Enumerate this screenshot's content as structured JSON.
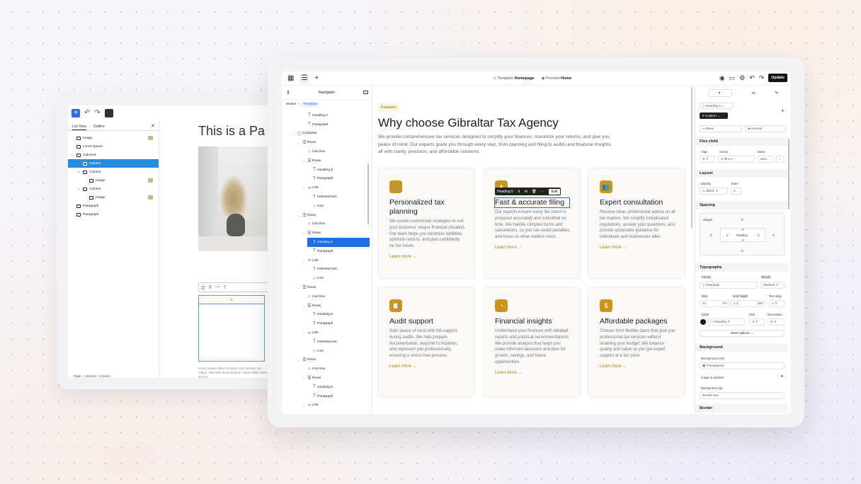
{
  "back_window": {
    "tabs": [
      "List View",
      "Outline"
    ],
    "close": "✕",
    "list": [
      {
        "label": "Image",
        "indent": 0,
        "thumb": true
      },
      {
        "label": "Lorem ipsum",
        "indent": 0
      },
      {
        "label": "Columns",
        "indent": 0,
        "arrow": "⌄"
      },
      {
        "label": "Column",
        "indent": 1,
        "selected": true
      },
      {
        "label": "Column",
        "indent": 1,
        "arrow": "⌄"
      },
      {
        "label": "Image",
        "indent": 2,
        "thumb": true
      },
      {
        "label": "Column",
        "indent": 1,
        "arrow": "⌄"
      },
      {
        "label": "Image",
        "indent": 2,
        "thumb": true
      },
      {
        "label": "Paragraph",
        "indent": 0
      },
      {
        "label": "Paragraph",
        "indent": 0
      }
    ],
    "page_title": "This is a Pa",
    "add_symbol": "+",
    "lorem": "Lorem ipsum dolor sit amet, cons tempor nec metus. Sed nibh lectu Aliquam rutrum diam dolor, vel mo",
    "breadcrumb": "Page › Columns › Column"
  },
  "topbar": {
    "template_label": "Template",
    "template_name": "Homepage",
    "preview_label": "Preview",
    "preview_name": "Home",
    "update": "Update"
  },
  "navigator": {
    "title": "Navigator",
    "breadcrumb": [
      "Master",
      "Template"
    ],
    "tree": [
      {
        "label": "Heading 2",
        "depth": 3,
        "glyph": "T"
      },
      {
        "label": "Paragraph",
        "depth": 3,
        "glyph": "T"
      },
      {
        "label": "Container",
        "depth": 1,
        "glyph": "▢",
        "arrow": "›"
      },
      {
        "label": "Rows",
        "depth": 2,
        "glyph": "☰",
        "arrow": "⌄"
      },
      {
        "label": "Icon box",
        "depth": 3,
        "glyph": "☆"
      },
      {
        "label": "Rows",
        "depth": 3,
        "glyph": "☰",
        "arrow": "⌄"
      },
      {
        "label": "Heading 5",
        "depth": 4,
        "glyph": "T"
      },
      {
        "label": "Paragraph",
        "depth": 4,
        "glyph": "T"
      },
      {
        "label": "Link",
        "depth": 3,
        "glyph": "∞",
        "arrow": "⌄"
      },
      {
        "label": "Inherited text",
        "depth": 4,
        "glyph": "T"
      },
      {
        "label": "Icon",
        "depth": 4,
        "glyph": "☆"
      },
      {
        "label": "Rows",
        "depth": 2,
        "glyph": "☰",
        "arrow": "⌄"
      },
      {
        "label": "Icon box",
        "depth": 3,
        "glyph": "☆"
      },
      {
        "label": "Rows",
        "depth": 3,
        "glyph": "☰",
        "arrow": "⌄"
      },
      {
        "label": "Heading 5",
        "depth": 4,
        "glyph": "T",
        "selected": true
      },
      {
        "label": "Paragraph",
        "depth": 4,
        "glyph": "T"
      },
      {
        "label": "Link",
        "depth": 3,
        "glyph": "∞",
        "arrow": "⌄"
      },
      {
        "label": "Inherited text",
        "depth": 4,
        "glyph": "T"
      },
      {
        "label": "Icon",
        "depth": 4,
        "glyph": "☆"
      },
      {
        "label": "Rows",
        "depth": 2,
        "glyph": "☰",
        "arrow": "⌄"
      },
      {
        "label": "Icon box",
        "depth": 3,
        "glyph": "☆"
      },
      {
        "label": "Rows",
        "depth": 3,
        "glyph": "☰",
        "arrow": "⌄"
      },
      {
        "label": "Heading 5",
        "depth": 4,
        "glyph": "T"
      },
      {
        "label": "Paragraph",
        "depth": 4,
        "glyph": "T"
      },
      {
        "label": "Link",
        "depth": 3,
        "glyph": "∞",
        "arrow": "⌄"
      },
      {
        "label": "Inherited text",
        "depth": 4,
        "glyph": "T"
      },
      {
        "label": "Icon",
        "depth": 4,
        "glyph": "☆"
      },
      {
        "label": "Rows",
        "depth": 2,
        "glyph": "☰",
        "arrow": "⌄"
      },
      {
        "label": "Icon box",
        "depth": 3,
        "glyph": "☆"
      },
      {
        "label": "Rows",
        "depth": 3,
        "glyph": "☰",
        "arrow": "⌄"
      },
      {
        "label": "Heading 5",
        "depth": 4,
        "glyph": "T"
      },
      {
        "label": "Paragraph",
        "depth": 4,
        "glyph": "T"
      },
      {
        "label": "Link",
        "depth": 3,
        "glyph": "∞",
        "arrow": "⌄"
      }
    ]
  },
  "canvas": {
    "badge": "Features",
    "title": "Why choose Gibraltar Tax Agency",
    "lead": "We provide comprehensive tax services designed to simplify your finances, maximize your returns, and give you peace of mind. Our experts guide you through every step, from planning and filing to audits and financial insights, all with clarity, precision, and affordable solutions.",
    "selection_toolbar": {
      "element": "Heading 5",
      "edit": "Edit"
    },
    "cards": [
      {
        "icon": "🚲",
        "title": "Personalized tax planning",
        "desc": "We create customized strategies to suit your business' unique financial situation. Our team helps you minimize liabilities, optimize returns, and plan confidently for the future.",
        "link": "Learn more →"
      },
      {
        "icon": "✦",
        "title": "Fast & accurate filing",
        "desc": "Our experts ensure every tax return is prepared accurately and submitted on time. We handle complex forms and calculations, so you can avoid penalties and focus on what matters most.",
        "link": "Learn more →",
        "editing": true
      },
      {
        "icon": "👥",
        "title": "Expert consultation",
        "desc": "Receive clear, professional advice on all tax matters. We simplify complicated regulations, answer your questions, and provide actionable guidance for individuals and businesses alike.",
        "link": "Learn more →"
      },
      {
        "icon": "📋",
        "title": "Audit support",
        "desc": "Gain peace of mind with full support during audits. We help prepare documentation, respond to inquiries, and represent you professionally, ensuring a stress-free process.",
        "link": "Learn more →"
      },
      {
        "icon": "◔",
        "title": "Financial insights",
        "desc": "Understand your finances with detailed reports and practical recommendations. We provide analysis that helps you make informed decisions and plan for growth, savings, and future opportunities.",
        "link": "Learn more →"
      },
      {
        "icon": "$",
        "title": "Affordable packages",
        "desc": "Choose from flexible plans that give you professional tax services without straining your budget. We balance quality and value so you get expert support at a fair price.",
        "link": "Learn more →"
      }
    ]
  },
  "props": {
    "element_tag": "Heading 5",
    "class_tag": "Custom",
    "state": "Base",
    "mode": "Normal",
    "flex_child": {
      "title": "Flex child",
      "align": "Align",
      "sizing": "Sizing",
      "basis": "Basis",
      "basis_value": "auto"
    },
    "layout": {
      "title": "Layout",
      "display": "Display",
      "order": "Order",
      "display_value": "Block",
      "order_value": "0"
    },
    "spacing": {
      "title": "Spacing",
      "margin": "Margin",
      "padding": "Padding",
      "values": [
        "0",
        "0",
        "0",
        "0",
        "0",
        "0",
        "0",
        "0",
        "0"
      ]
    },
    "typography": {
      "title": "Typography",
      "family": "Family",
      "weight": "Weight",
      "family_value": "Headings",
      "weight_value": "Medium",
      "size": "Size",
      "line_height": "Line height",
      "text_align": "Text align",
      "size_value": "24",
      "size_unit": "PX",
      "lh_value": "1.4",
      "lh_unit": "EM",
      "color": "Color",
      "italic": "Italic",
      "decoration": "Decoration",
      "color_value": "Heading",
      "more": "More options ⌄"
    },
    "background": {
      "title": "Background",
      "bg_color": "Background color",
      "bg_value": "Transparent",
      "image_gradient": "Image & gradient",
      "clip": "Background clip",
      "clip_value": "Border box"
    },
    "border": {
      "title": "Border"
    }
  },
  "colors": {
    "accent": "#c9961b",
    "selection": "#1a6fe6",
    "list_selected": "#2d8ad4"
  }
}
